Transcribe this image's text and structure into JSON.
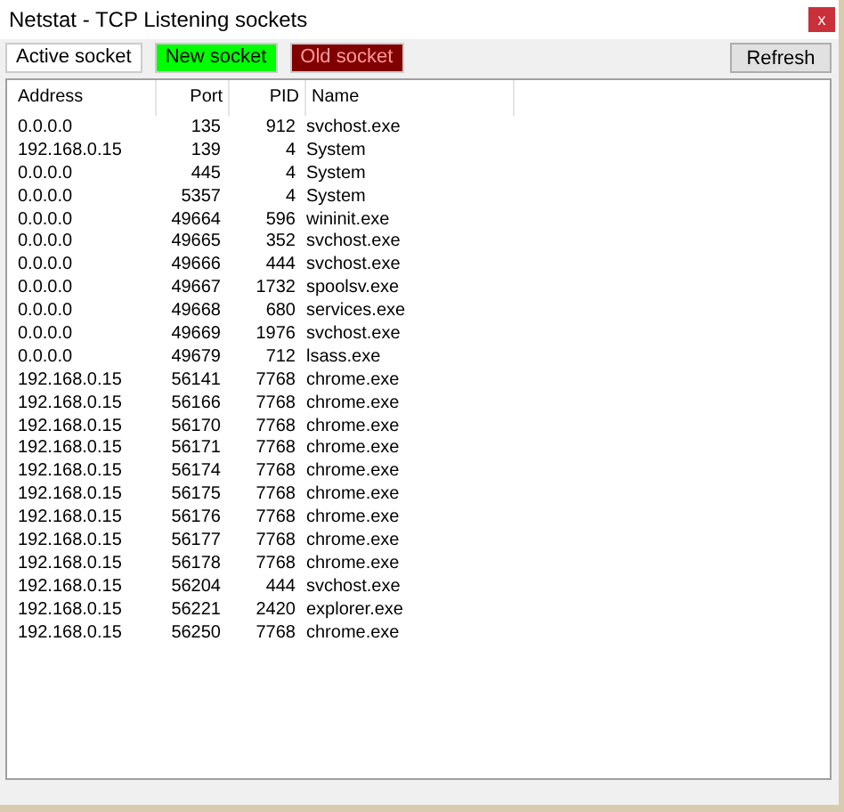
{
  "window": {
    "title": "Netstat - TCP Listening sockets",
    "close": "x"
  },
  "legend": [
    {
      "label": "Active socket",
      "color": "#ffffff"
    },
    {
      "label": "New socket",
      "color": "#00ff00"
    },
    {
      "label": "Old socket",
      "color": "#800000"
    }
  ],
  "buttons": [
    "Refresh"
  ],
  "table": {
    "columns": [
      "Address",
      "Port",
      "PID",
      "Name"
    ],
    "rows": [
      [
        "0.0.0.0",
        "135",
        "912",
        "svchost.exe"
      ],
      [
        "192.168.0.15",
        "139",
        "4",
        "System"
      ],
      [
        "0.0.0.0",
        "445",
        "4",
        "System"
      ],
      [
        "0.0.0.0",
        "5357",
        "4",
        "System"
      ],
      [
        "0.0.0.0",
        "49664",
        "596",
        "wininit.exe"
      ],
      [
        "0.0.0.0",
        "49665",
        "352",
        "svchost.exe"
      ],
      [
        "0.0.0.0",
        "49666",
        "444",
        "svchost.exe"
      ],
      [
        "0.0.0.0",
        "49667",
        "1732",
        "spoolsv.exe"
      ],
      [
        "0.0.0.0",
        "49668",
        "680",
        "services.exe"
      ],
      [
        "0.0.0.0",
        "49669",
        "1976",
        "svchost.exe"
      ],
      [
        "0.0.0.0",
        "49679",
        "712",
        "lsass.exe"
      ],
      [
        "192.168.0.15",
        "56141",
        "7768",
        "chrome.exe"
      ],
      [
        "192.168.0.15",
        "56166",
        "7768",
        "chrome.exe"
      ],
      [
        "192.168.0.15",
        "56170",
        "7768",
        "chrome.exe"
      ],
      [
        "192.168.0.15",
        "56171",
        "7768",
        "chrome.exe"
      ],
      [
        "192.168.0.15",
        "56174",
        "7768",
        "chrome.exe"
      ],
      [
        "192.168.0.15",
        "56175",
        "7768",
        "chrome.exe"
      ],
      [
        "192.168.0.15",
        "56176",
        "7768",
        "chrome.exe"
      ],
      [
        "192.168.0.15",
        "56177",
        "7768",
        "chrome.exe"
      ],
      [
        "192.168.0.15",
        "56178",
        "7768",
        "chrome.exe"
      ],
      [
        "192.168.0.15",
        "56204",
        "444",
        "svchost.exe"
      ],
      [
        "192.168.0.15",
        "56221",
        "2420",
        "explorer.exe"
      ],
      [
        "192.168.0.15",
        "56250",
        "7768",
        "chrome.exe"
      ]
    ]
  }
}
